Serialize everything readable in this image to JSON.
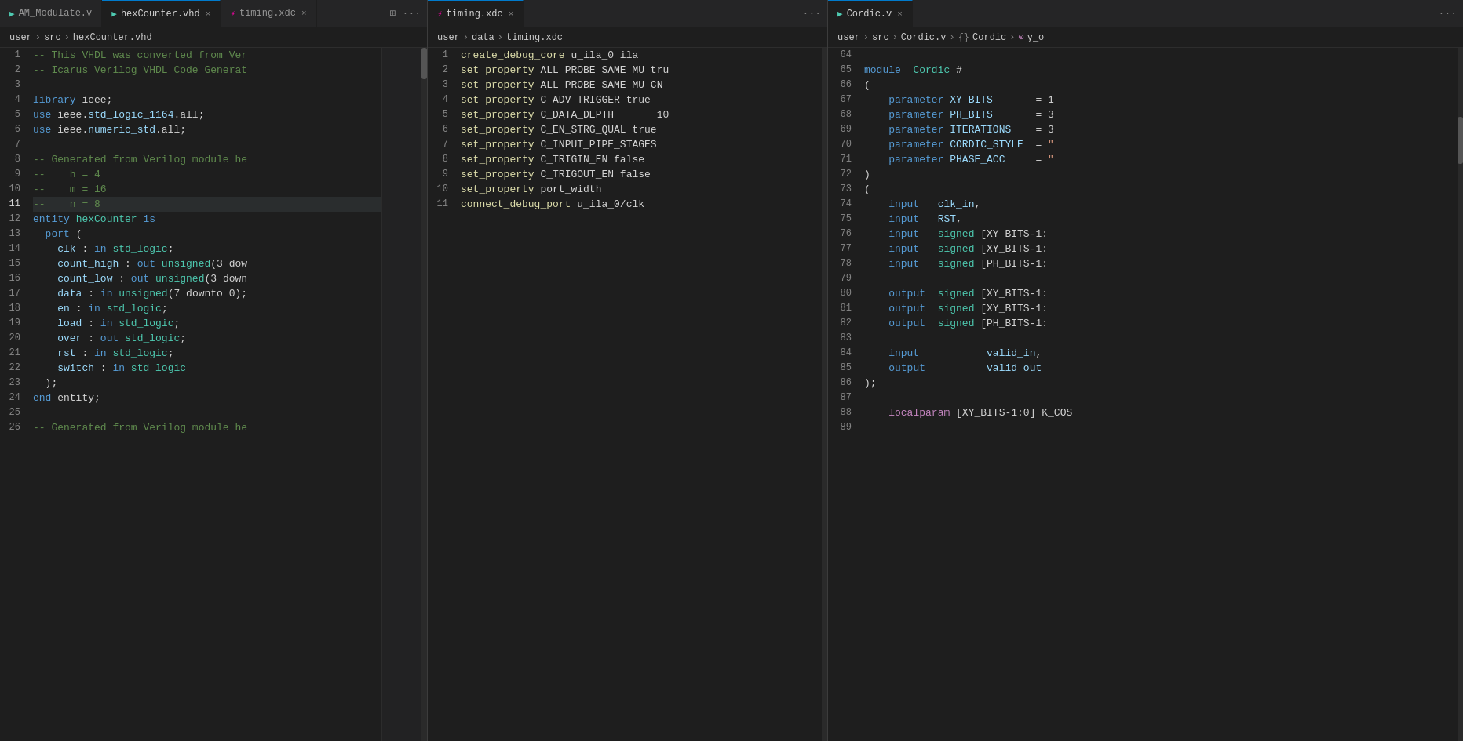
{
  "tabs": {
    "pane1": [
      {
        "label": "AM_Modulate.v",
        "active": false,
        "icon": "V",
        "closable": false
      },
      {
        "label": "hexCounter.vhd",
        "active": true,
        "icon": "V",
        "closable": true
      },
      {
        "label": "timing.xdc",
        "active": false,
        "icon": "X",
        "closable": true
      }
    ],
    "pane2": [
      {
        "label": "timing.xdc",
        "active": true,
        "icon": "X",
        "closable": true
      }
    ],
    "pane3": [
      {
        "label": "Cordic.v",
        "active": true,
        "icon": "V",
        "closable": true
      }
    ]
  },
  "breadcrumbs": {
    "pane1": "user > src > hexCounter.vhd",
    "pane2": "user > data > timing.xdc",
    "pane3": "user > src > Cordic.v > {} Cordic > y_o"
  },
  "pane1": {
    "startLine": 1,
    "lines": [
      "  <span class='c-comment'>-- This VHDL was converted from Ver</span>",
      "  <span class='c-comment'>-- Icarus Verilog VHDL Code Generat</span>",
      "",
      "  <span class='c-keyword'>library</span> ieee;",
      "  <span class='c-keyword'>use</span> ieee.std_logic_1164.<span class='c-white'>all</span>;",
      "  <span class='c-keyword'>use</span> ieee.numeric_std.<span class='c-white'>all</span>;",
      "",
      "  <span class='c-comment'>-- Generated from Verilog module he</span>",
      "  <span class='c-comment'>--    h = 4</span>",
      "  <span class='c-comment'>--    m = 16</span>",
      "  <span class='c-comment'>--    n = 8</span>",
      "  <span class='c-keyword'>entity</span> <span class='c-type'>hexCounter</span> <span class='c-keyword'>is</span>",
      "    <span class='c-keyword'>port</span> (",
      "      <span class='c-ident'>clk</span> : <span class='c-keyword'>in</span> <span class='c-type'>std_logic</span>;",
      "      <span class='c-ident'>count_high</span> : <span class='c-keyword'>out</span> <span class='c-type'>unsigned</span>(3 dow",
      "      <span class='c-ident'>count_low</span> : <span class='c-keyword'>out</span> <span class='c-type'>unsigned</span>(3 down",
      "      <span class='c-ident'>data</span> : <span class='c-keyword'>in</span> <span class='c-type'>unsigned</span>(7 downto 0);",
      "      <span class='c-ident'>en</span> : <span class='c-keyword'>in</span> <span class='c-type'>std_logic</span>;",
      "      <span class='c-ident'>load</span> : <span class='c-keyword'>in</span> <span class='c-type'>std_logic</span>;",
      "      <span class='c-ident'>over</span> : <span class='c-keyword'>out</span> <span class='c-type'>std_logic</span>;",
      "      <span class='c-ident'>rst</span> : <span class='c-keyword'>in</span> <span class='c-type'>std_logic</span>;",
      "      <span class='c-ident'>switch</span> : <span class='c-keyword'>in</span> <span class='c-type'>std_logic</span>",
      "    );",
      "  <span class='c-keyword'>end</span> entity;",
      "",
      "  <span class='c-comment'>-- Generated from Verilog module he</span>"
    ]
  },
  "pane2": {
    "startLine": 1,
    "lines": [
      "  <span class='c-orange'>create_debug_core</span> u_ila_0 ila",
      "  <span class='c-orange'>set_property</span> ALL_PROBE_SAME_MU tru",
      "  <span class='c-orange'>set_property</span> ALL_PROBE_SAME_MU_CN",
      "  <span class='c-orange'>set_property</span> C_ADV_TRIGGER true",
      "  <span class='c-orange'>set_property</span> C_DATA_DEPTH       10",
      "  <span class='c-orange'>set_property</span> C_EN_STRG_QUAL true",
      "  <span class='c-orange'>set_property</span> C_INPUT_PIPE_STAGES",
      "  <span class='c-orange'>set_property</span> C_TRIGIN_EN false",
      "  <span class='c-orange'>set_property</span> C_TRIGOUT_EN false",
      "  <span class='c-orange'>set_property</span> port_width",
      "  <span class='c-orange'>connect_debug_port</span> u_ila_0/clk"
    ]
  },
  "pane3": {
    "startLine": 64,
    "lines": [
      "",
      "  <span class='c-keyword'>module</span>  <span class='c-module'>Cordic</span> #",
      "  <span class='c-punct'>(</span>",
      "      <span class='c-keyword'>parameter</span> XY_BITS    = 1",
      "      <span class='c-keyword'>parameter</span> PH_BITS    = 3",
      "      <span class='c-keyword'>parameter</span> ITERATIONS = 3",
      "      <span class='c-keyword'>parameter</span> CORDIC_STYLE = \"",
      "      <span class='c-keyword'>parameter</span> PHASE_ACC   = \"",
      "  <span class='c-punct'>)</span>",
      "  <span class='c-punct'>(</span>",
      "      <span class='c-io'>input</span>   <span class='c-ident'>clk_in</span>,",
      "      <span class='c-io'>input</span>   <span class='c-ident'>RST</span>,",
      "      <span class='c-io'>input</span>   <span class='c-signed'>signed</span> [XY_BITS-1:",
      "      <span class='c-io'>input</span>   <span class='c-signed'>signed</span> [XY_BITS-1:",
      "      <span class='c-io'>input</span>   <span class='c-signed'>signed</span> [PH_BITS-1:",
      "",
      "      <span class='c-output'>output</span>  <span class='c-signed'>signed</span> [XY_BITS-1:",
      "      <span class='c-output'>output</span>  <span class='c-signed'>signed</span> [XY_BITS-1:",
      "      <span class='c-output'>output</span>  <span class='c-signed'>signed</span> [PH_BITS-1:",
      "",
      "      <span class='c-io'>input</span>           <span class='c-valid'>valid_in</span>,",
      "      <span class='c-output'>output</span>          <span class='c-valid'>valid_out</span>",
      "  <span class='c-punct'>);</span>",
      "",
      "      <span class='c-local'>localparam</span> [XY_BITS-1:0] K_COS"
    ]
  },
  "ui": {
    "ellipsis": "···",
    "splitIcon": "⊞",
    "closeChar": "×",
    "fileIconV": "≡",
    "fileIconX": "⚡"
  }
}
